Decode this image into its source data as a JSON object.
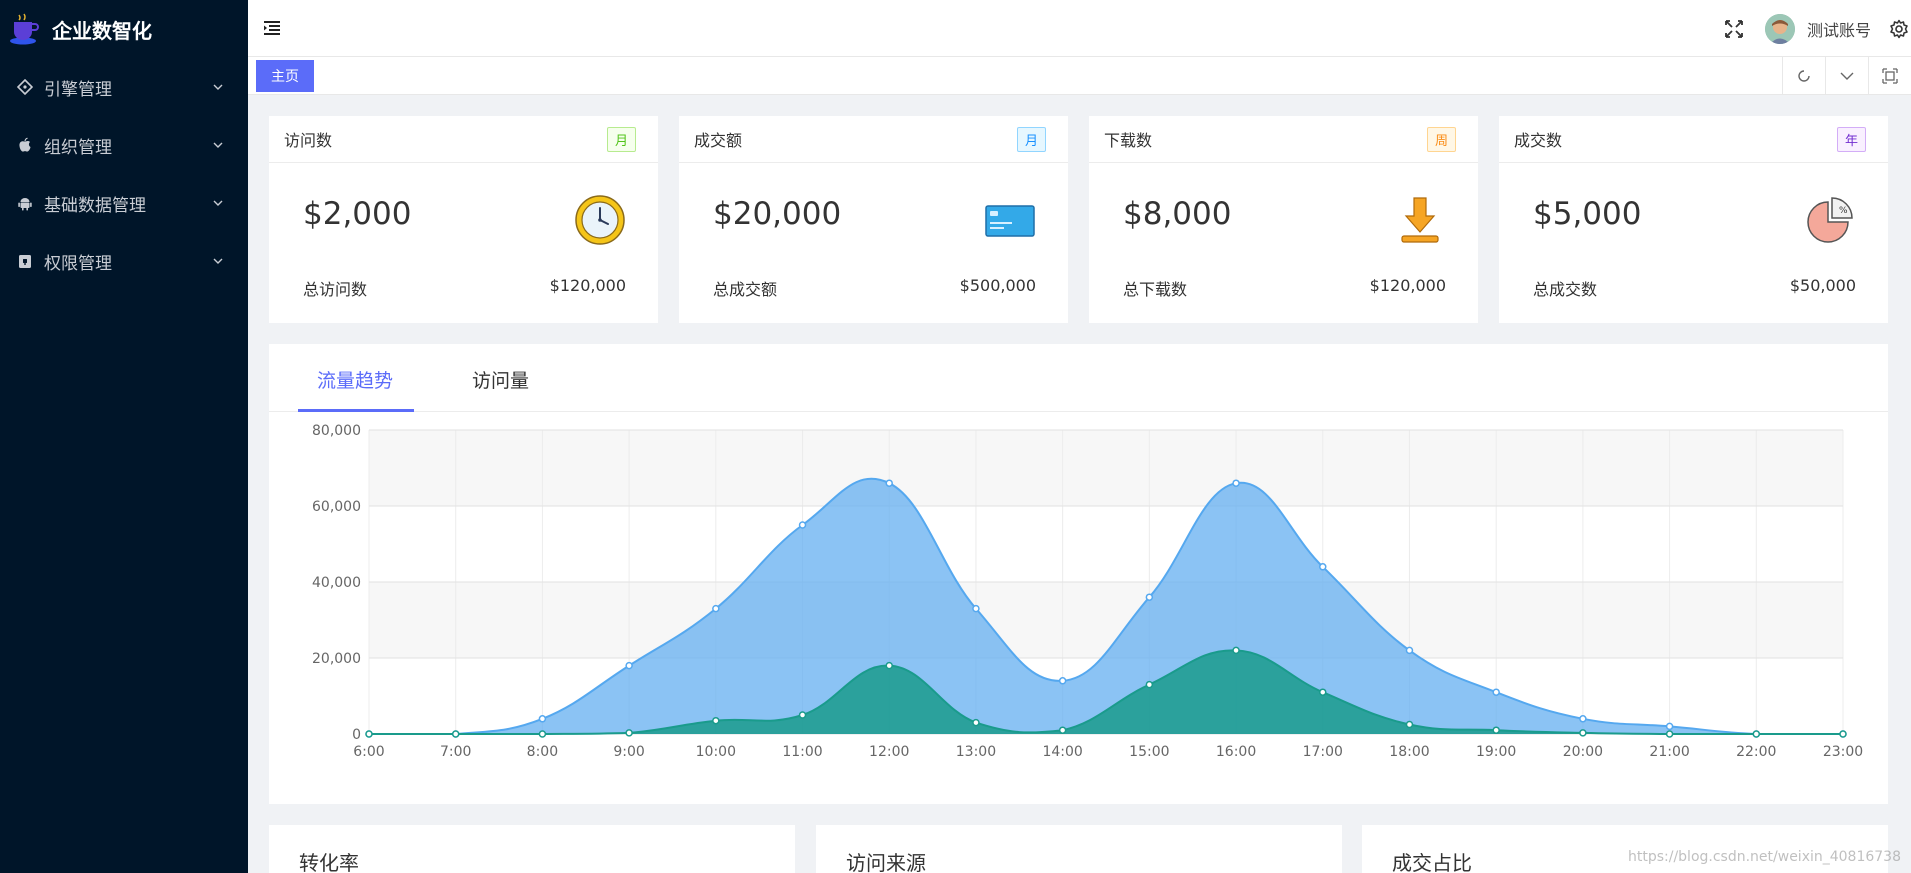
{
  "app": {
    "title": "企业数智化"
  },
  "sidebar": {
    "items": [
      {
        "label": "引擎管理"
      },
      {
        "label": "组织管理"
      },
      {
        "label": "基础数据管理"
      },
      {
        "label": "权限管理"
      }
    ]
  },
  "header": {
    "username": "测试账号"
  },
  "tabs": {
    "home": "主页"
  },
  "stats": [
    {
      "title": "访问数",
      "badge": "月",
      "badge_color": "#52c41a",
      "value": "$2,000",
      "foot_label": "总访问数",
      "foot_value": "$120,000",
      "icon": "clock-icon"
    },
    {
      "title": "成交额",
      "badge": "月",
      "badge_color": "#1890ff",
      "value": "$20,000",
      "foot_label": "总成交额",
      "foot_value": "$500,000",
      "icon": "credit-card-icon"
    },
    {
      "title": "下载数",
      "badge": "周",
      "badge_color": "#fa8c16",
      "value": "$8,000",
      "foot_label": "总下载数",
      "foot_value": "$120,000",
      "icon": "download-icon"
    },
    {
      "title": "成交数",
      "badge": "年",
      "badge_color": "#722ed1",
      "value": "$5,000",
      "foot_label": "总成交数",
      "foot_value": "$50,000",
      "icon": "pie-chart-icon"
    }
  ],
  "chart_tabs": [
    "流量趋势",
    "访问量"
  ],
  "chart_data": {
    "type": "area",
    "categories": [
      "6:00",
      "7:00",
      "8:00",
      "9:00",
      "10:00",
      "11:00",
      "12:00",
      "13:00",
      "14:00",
      "15:00",
      "16:00",
      "17:00",
      "18:00",
      "19:00",
      "20:00",
      "21:00",
      "22:00",
      "23:00"
    ],
    "ylim": [
      0,
      80000
    ],
    "yticks": [
      "0",
      "20,000",
      "40,000",
      "60,000",
      "80,000"
    ],
    "grid": true,
    "series": [
      {
        "values": [
          0,
          0,
          4000,
          18000,
          33000,
          55000,
          66000,
          33000,
          14000,
          36000,
          66000,
          44000,
          22000,
          11000,
          4000,
          2000,
          0,
          0
        ],
        "color": "#55a8ef"
      },
      {
        "values": [
          0,
          0,
          0,
          300,
          3500,
          5000,
          18000,
          3000,
          1000,
          13000,
          22000,
          11000,
          2500,
          1000,
          300,
          0,
          0,
          0
        ],
        "color": "#1a9b8c"
      }
    ]
  },
  "bottom_cards": [
    "转化率",
    "访问来源",
    "成交占比"
  ],
  "watermark": "https://blog.csdn.net/weixin_40816738"
}
